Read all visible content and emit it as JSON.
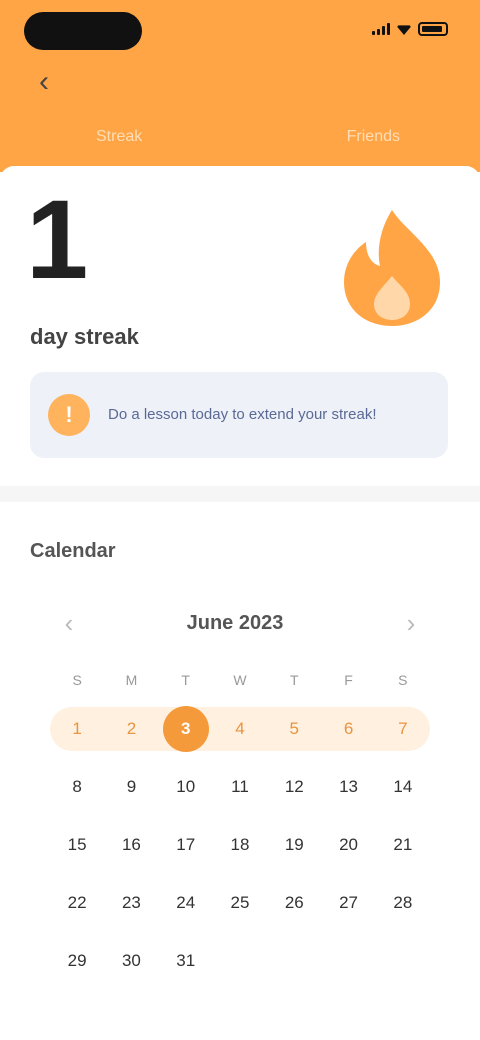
{
  "statusbar": {
    "icons": [
      "signal-icon",
      "wifi-icon",
      "battery-icon"
    ]
  },
  "header": {
    "back_icon": "chevron-left-icon",
    "tabs": [
      {
        "label": "Streak"
      },
      {
        "label": "Friends"
      }
    ]
  },
  "streak": {
    "count": "1",
    "label": "day streak",
    "flame_icon": "flame-icon",
    "info_text": "Do a lesson today to extend your streak!"
  },
  "calendar": {
    "title": "Calendar",
    "month": "June 2023",
    "weekdays": [
      "S",
      "M",
      "T",
      "W",
      "T",
      "F",
      "S"
    ],
    "weeks": [
      [
        "1",
        "2",
        "3",
        "4",
        "5",
        "6",
        "7"
      ],
      [
        "8",
        "9",
        "10",
        "11",
        "12",
        "13",
        "14"
      ],
      [
        "15",
        "16",
        "17",
        "18",
        "19",
        "20",
        "21"
      ],
      [
        "22",
        "23",
        "24",
        "25",
        "26",
        "27",
        "28"
      ],
      [
        "29",
        "30",
        "31",
        "",
        "",
        "",
        ""
      ]
    ],
    "today": "3"
  },
  "colors": {
    "accent": "#ffa545",
    "today": "#f59a3a",
    "highlight": "#fff0df",
    "info_bg": "#eef1f8"
  }
}
